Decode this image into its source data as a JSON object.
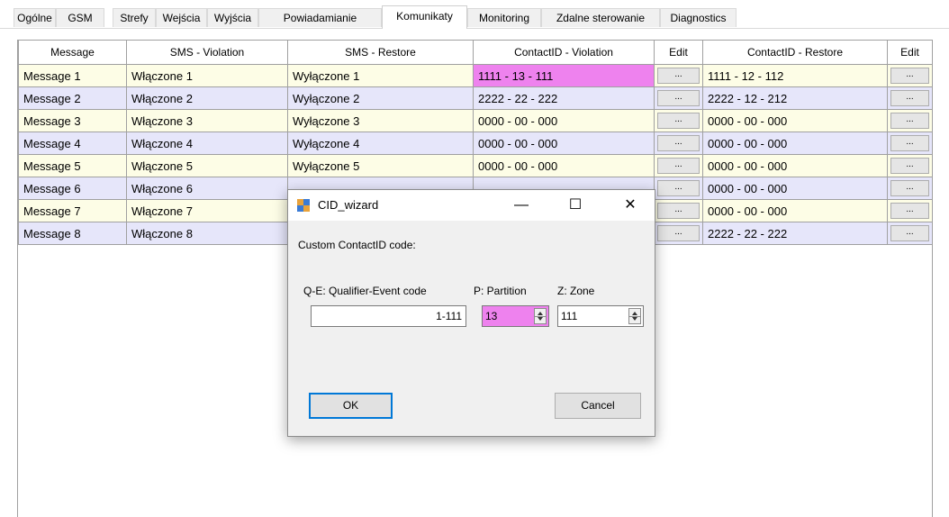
{
  "tabs": [
    {
      "label": "Ogólne"
    },
    {
      "label": "GSM"
    },
    {
      "label": "Strefy"
    },
    {
      "label": "Wejścia"
    },
    {
      "label": "Wyjścia"
    },
    {
      "label": "Powiadamianie"
    },
    {
      "label": "Komunikaty",
      "active": true
    },
    {
      "label": "Monitoring"
    },
    {
      "label": "Zdalne sterowanie"
    },
    {
      "label": "Diagnostics"
    }
  ],
  "grid": {
    "headers": [
      "Message",
      "SMS - Violation",
      "SMS - Restore",
      "ContactID - Violation",
      "Edit",
      "ContactID - Restore",
      "Edit"
    ],
    "edit_label": "...",
    "rows": [
      {
        "message": "Message 1",
        "sms_violation": "Włączone 1",
        "sms_restore": "Wyłączone 1",
        "cid_violation": "1111 - 13 - 111",
        "cid_restore": "1111 - 12 - 112"
      },
      {
        "message": "Message 2",
        "sms_violation": "Włączone 2",
        "sms_restore": "Wyłączone 2",
        "cid_violation": "2222 - 22 - 222",
        "cid_restore": "2222 - 12 - 212"
      },
      {
        "message": "Message 3",
        "sms_violation": "Włączone 3",
        "sms_restore": "Wyłączone 3",
        "cid_violation": "0000 - 00 - 000",
        "cid_restore": "0000 - 00 - 000"
      },
      {
        "message": "Message 4",
        "sms_violation": "Włączone 4",
        "sms_restore": "Wyłączone 4",
        "cid_violation": "0000 - 00 - 000",
        "cid_restore": "0000 - 00 - 000"
      },
      {
        "message": "Message 5",
        "sms_violation": "Włączone 5",
        "sms_restore": "Wyłączone 5",
        "cid_violation": "0000 - 00 - 000",
        "cid_restore": "0000 - 00 - 000"
      },
      {
        "message": "Message 6",
        "sms_violation": "Włączone 6",
        "sms_restore": "",
        "cid_violation": "",
        "cid_restore": "0000 - 00 - 000"
      },
      {
        "message": "Message 7",
        "sms_violation": "Włączone 7",
        "sms_restore": "",
        "cid_violation": "",
        "cid_restore": "0000 - 00 - 000"
      },
      {
        "message": "Message 8",
        "sms_violation": "Włączone 8",
        "sms_restore": "",
        "cid_violation": "",
        "cid_restore": "2222 - 22 - 222"
      }
    ]
  },
  "dialog": {
    "title": "CID_wizard",
    "minimize": "—",
    "maximize": "☐",
    "close": "✕",
    "custom_label": "Custom ContactID code:",
    "qe_label": "Q-E: Qualifier-Event code",
    "qe_value": "1-111",
    "partition_label": "P: Partition",
    "partition_value": "13",
    "zone_label": "Z: Zone",
    "zone_value": "111",
    "ok_label": "OK",
    "cancel_label": "Cancel"
  },
  "colors": {
    "highlight": "#ee82ee",
    "row_odd": "#fdfde6",
    "row_even": "#e6e6fa",
    "focus_border": "#0078d7"
  }
}
